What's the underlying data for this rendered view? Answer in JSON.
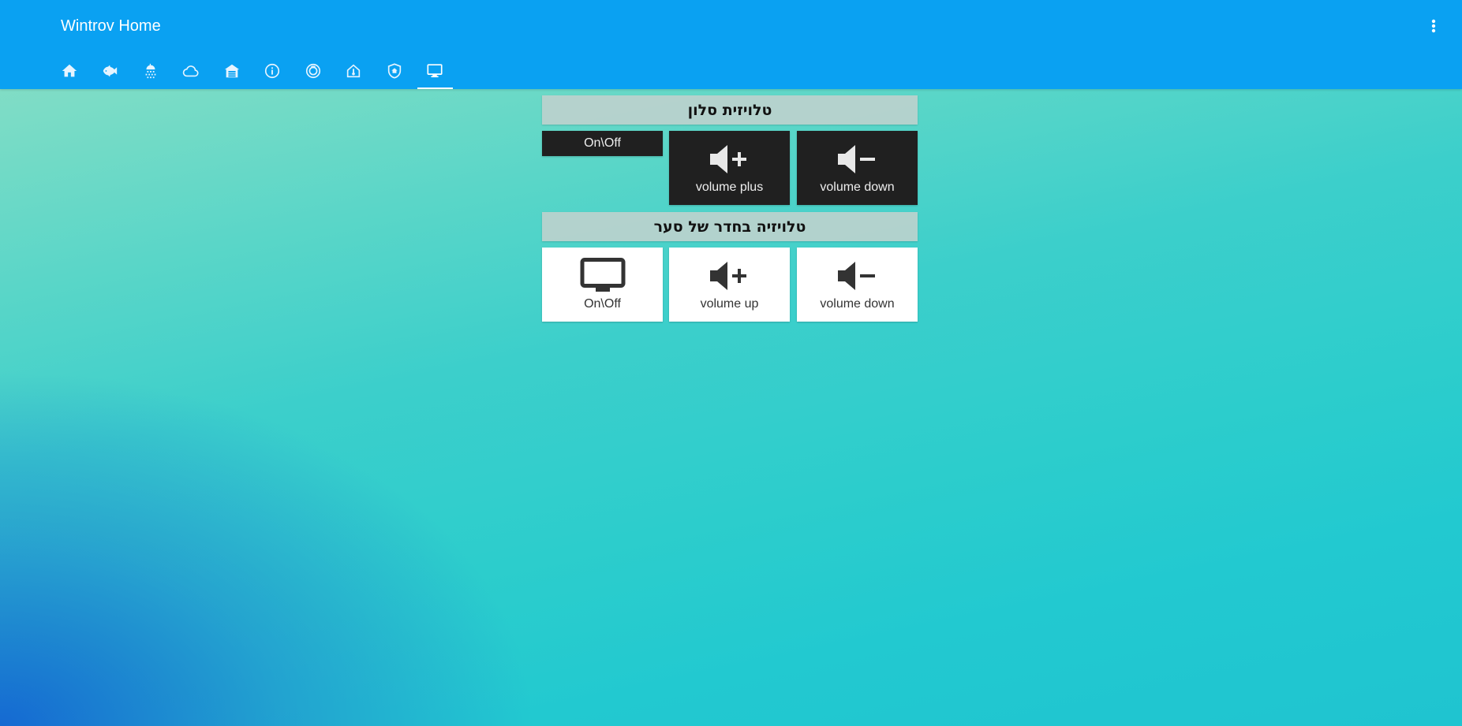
{
  "header": {
    "title": "Wintrov Home",
    "tabs": [
      {
        "icon": "home-icon"
      },
      {
        "icon": "fish-icon"
      },
      {
        "icon": "shower-icon"
      },
      {
        "icon": "cloud-icon"
      },
      {
        "icon": "home-garage-icon"
      },
      {
        "icon": "information-icon"
      },
      {
        "icon": "robot-vacuum-icon"
      },
      {
        "icon": "home-thermometer-icon"
      },
      {
        "icon": "shield-home-icon"
      },
      {
        "icon": "monitor-icon",
        "active": true
      }
    ],
    "menu_icon": "dots-vertical-icon"
  },
  "groups": [
    {
      "title": "טלויזית סלון",
      "style": "dark",
      "tiles": [
        {
          "label": "On\\Off",
          "icon": "none"
        },
        {
          "label": "volume plus",
          "icon": "volume-plus-icon"
        },
        {
          "label": "volume down",
          "icon": "volume-minus-icon"
        }
      ]
    },
    {
      "title": "טלויזיה בחדר של סער",
      "style": "light",
      "tiles": [
        {
          "label": "On\\Off",
          "icon": "monitor-icon"
        },
        {
          "label": "volume up",
          "icon": "volume-plus-icon"
        },
        {
          "label": "volume down",
          "icon": "volume-minus-icon"
        }
      ]
    }
  ],
  "colors": {
    "header": "#0aa1f2",
    "dark_tile": "#202020",
    "light_tile": "#ffffff",
    "group_header": "#bed2cd"
  }
}
